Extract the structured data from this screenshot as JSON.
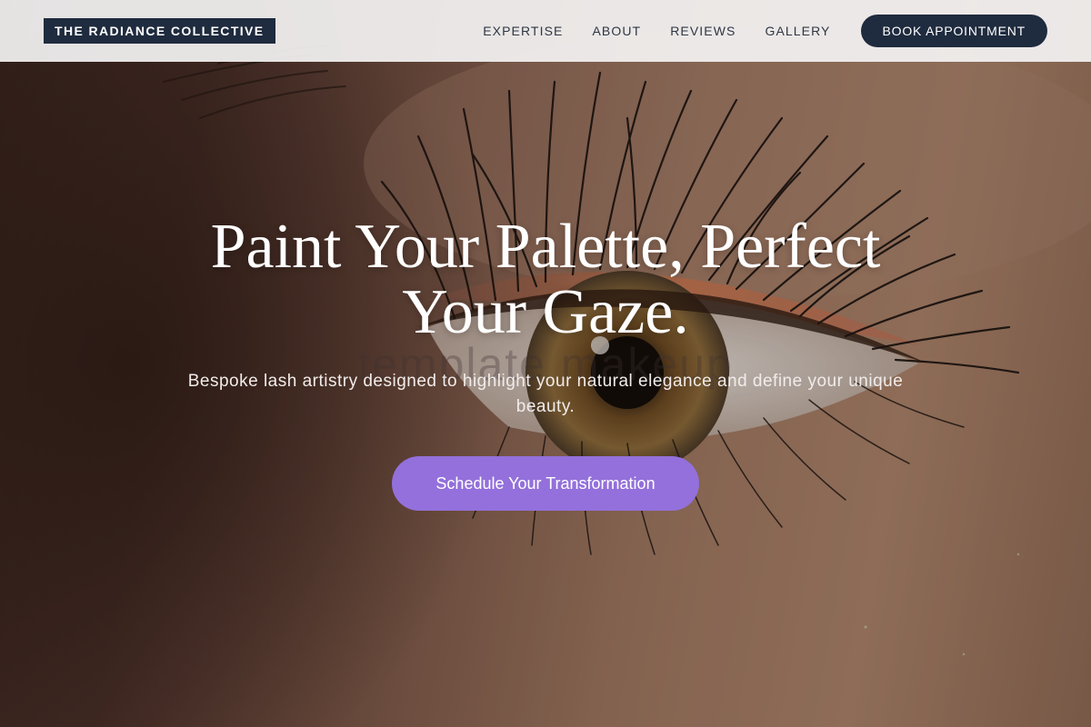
{
  "header": {
    "brand": "THE RADIANCE COLLECTIVE",
    "nav": [
      {
        "label": "EXPERTISE"
      },
      {
        "label": "ABOUT"
      },
      {
        "label": "REVIEWS"
      },
      {
        "label": "GALLERY"
      }
    ],
    "book_button": "BOOK APPOINTMENT"
  },
  "hero": {
    "title": "Paint Your Palette, Perfect Your Gaze.",
    "watermark": "template makeup",
    "subtitle": "Bespoke lash artistry designed to highlight your natural elegance and define your unique beauty.",
    "cta": "Schedule Your Transformation"
  },
  "colors": {
    "brand_navy": "#1f2b3e",
    "cta_purple": "#9370db",
    "header_bg": "#f3f2f2"
  }
}
